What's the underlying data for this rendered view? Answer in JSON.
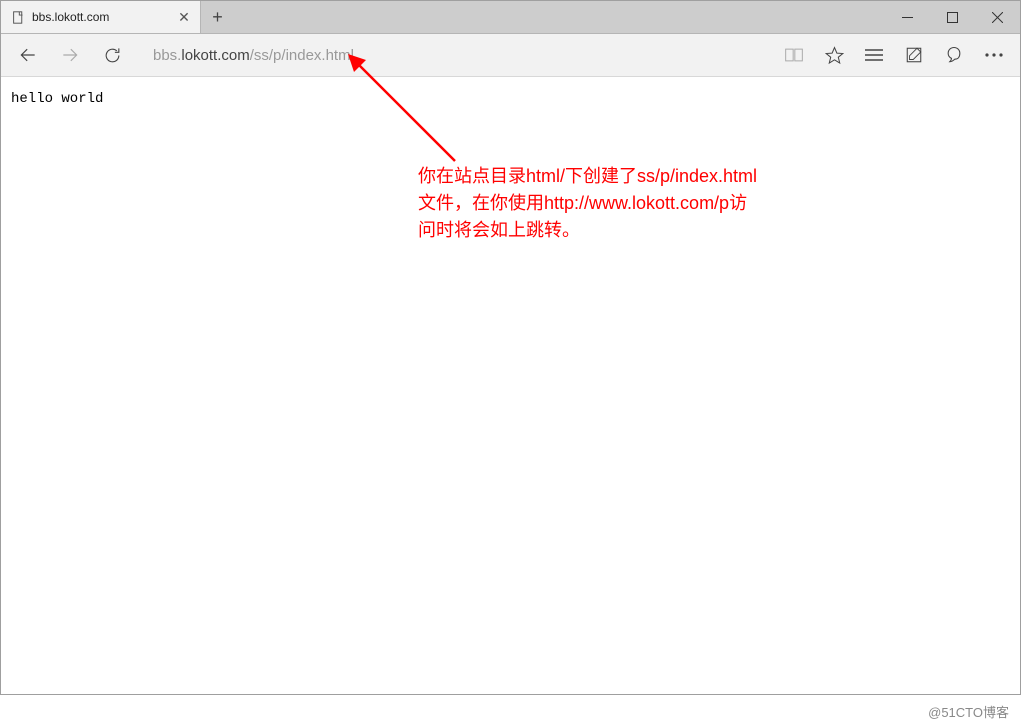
{
  "tab": {
    "title": "bbs.lokott.com"
  },
  "url": {
    "host_prefix": "bbs.",
    "host_main": "lokott.com",
    "path": "/ss/p/index.html"
  },
  "page": {
    "body_text": "hello world"
  },
  "annotation": {
    "line1": "你在站点目录html/下创建了ss/p/index.html",
    "line2": "文件，在你使用http://www.lokott.com/p访",
    "line3": "问时将会如上跳转。"
  },
  "watermark": "@51CTO博客"
}
